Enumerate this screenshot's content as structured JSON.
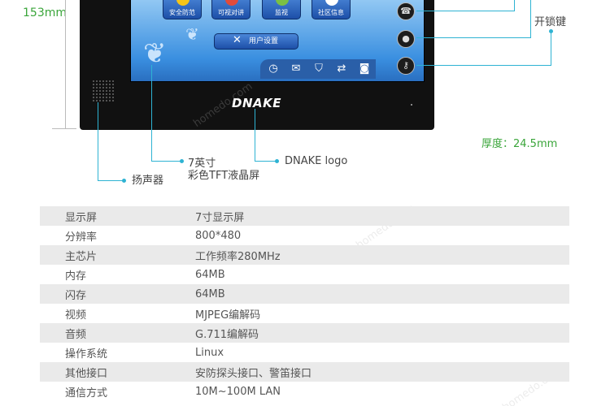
{
  "dimension": {
    "height_label": "153mm",
    "thickness_label": "厚度：24.5mm"
  },
  "device": {
    "brand_logo": "DNAKE",
    "screen_apps": [
      {
        "label": "安全防范",
        "icon": "shield-icon",
        "color": "#f5c518"
      },
      {
        "label": "可视对讲",
        "icon": "intercom-icon",
        "color": "#e24b3b"
      },
      {
        "label": "监视",
        "icon": "monitor-icon",
        "color": "#7bc043"
      },
      {
        "label": "社区信息",
        "icon": "info-icon",
        "color": "#ffffff"
      }
    ],
    "user_settings_label": "用户设置",
    "tray_icons": [
      "clock-icon",
      "mail-icon",
      "shield-icon",
      "refresh-icon",
      "camera-icon"
    ],
    "side_buttons": [
      "handset-icon",
      "user-icon",
      "key-icon"
    ]
  },
  "callouts": {
    "unlock_key": "开锁键",
    "screen_line1": "7英寸",
    "screen_line2": "彩色TFT液晶屏",
    "logo": "DNAKE logo",
    "speaker": "扬声器"
  },
  "watermark": "homedo.com",
  "specs": [
    {
      "key": "显示屏",
      "value": "7寸显示屏"
    },
    {
      "key": "分辨率",
      "value": "800*480"
    },
    {
      "key": "主芯片",
      "value": "工作频率280MHz"
    },
    {
      "key": "内存",
      "value": "64MB"
    },
    {
      "key": "闪存",
      "value": "64MB"
    },
    {
      "key": "视频",
      "value": "MJPEG编解码"
    },
    {
      "key": "音频",
      "value": "G.711编解码"
    },
    {
      "key": "操作系统",
      "value": "Linux"
    },
    {
      "key": "其他接口",
      "value": "安防探头接口、警笛接口"
    },
    {
      "key": "通信方式",
      "value": "10M~100M LAN"
    }
  ],
  "colors": {
    "accent_green": "#3aa53a",
    "callout_blue": "#2eb3d3",
    "row_shade": "#eaeaea"
  }
}
